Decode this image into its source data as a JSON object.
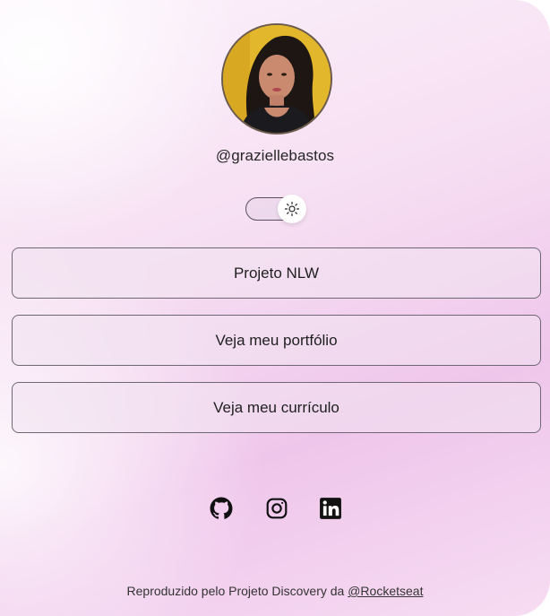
{
  "profile": {
    "handle": "@graziellebastos"
  },
  "theme_toggle": {
    "icon": "sun-icon",
    "state": "light"
  },
  "links": [
    {
      "label": "Projeto NLW"
    },
    {
      "label": "Veja meu portfólio"
    },
    {
      "label": "Veja meu currículo"
    }
  ],
  "social": [
    {
      "icon": "github-icon"
    },
    {
      "icon": "instagram-icon"
    },
    {
      "icon": "linkedin-icon"
    }
  ],
  "footer": {
    "text": "Reproduzido pelo Projeto Discovery da ",
    "link_label": "@Rocketseat"
  },
  "colors": {
    "accent_pink": "#efc6eb",
    "border": "#6e6874"
  }
}
